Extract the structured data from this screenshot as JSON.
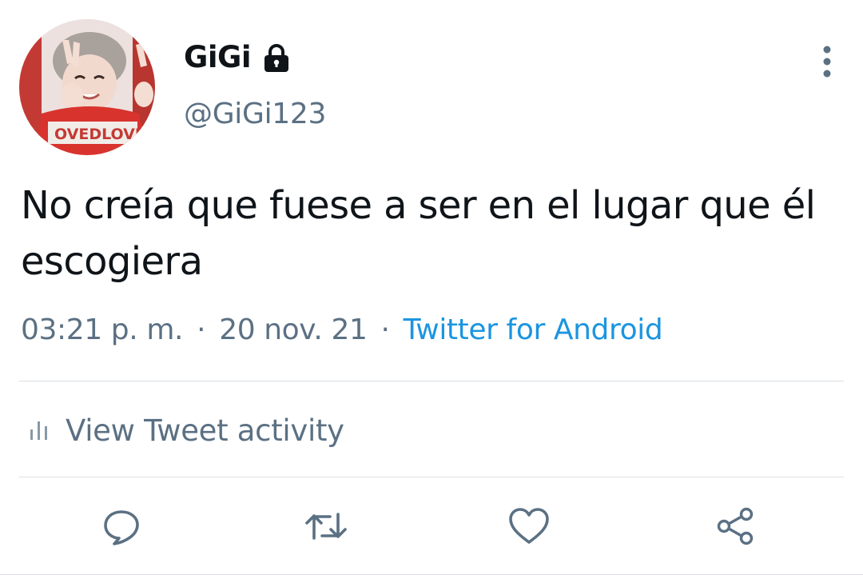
{
  "author": {
    "display_name": "GiGi",
    "username": "@GiGi123",
    "protected": true
  },
  "tweet": {
    "text": "No creía que fuese a ser en el lugar que él escogiera",
    "time": "03:21 p. m.",
    "date": "20 nov. 21",
    "source": "Twitter for Android",
    "separator": "·"
  },
  "activity": {
    "label": "View Tweet activity"
  },
  "icons": {
    "lock": "lock-icon",
    "more": "more-vertical-icon",
    "activity": "bar-chart-icon",
    "reply": "reply-icon",
    "retweet": "retweet-icon",
    "like": "heart-icon",
    "share": "share-icon"
  },
  "colors": {
    "text_primary": "#0f1419",
    "text_secondary": "#5b7083",
    "link": "#1b95e0",
    "divider": "#d9dee3"
  }
}
